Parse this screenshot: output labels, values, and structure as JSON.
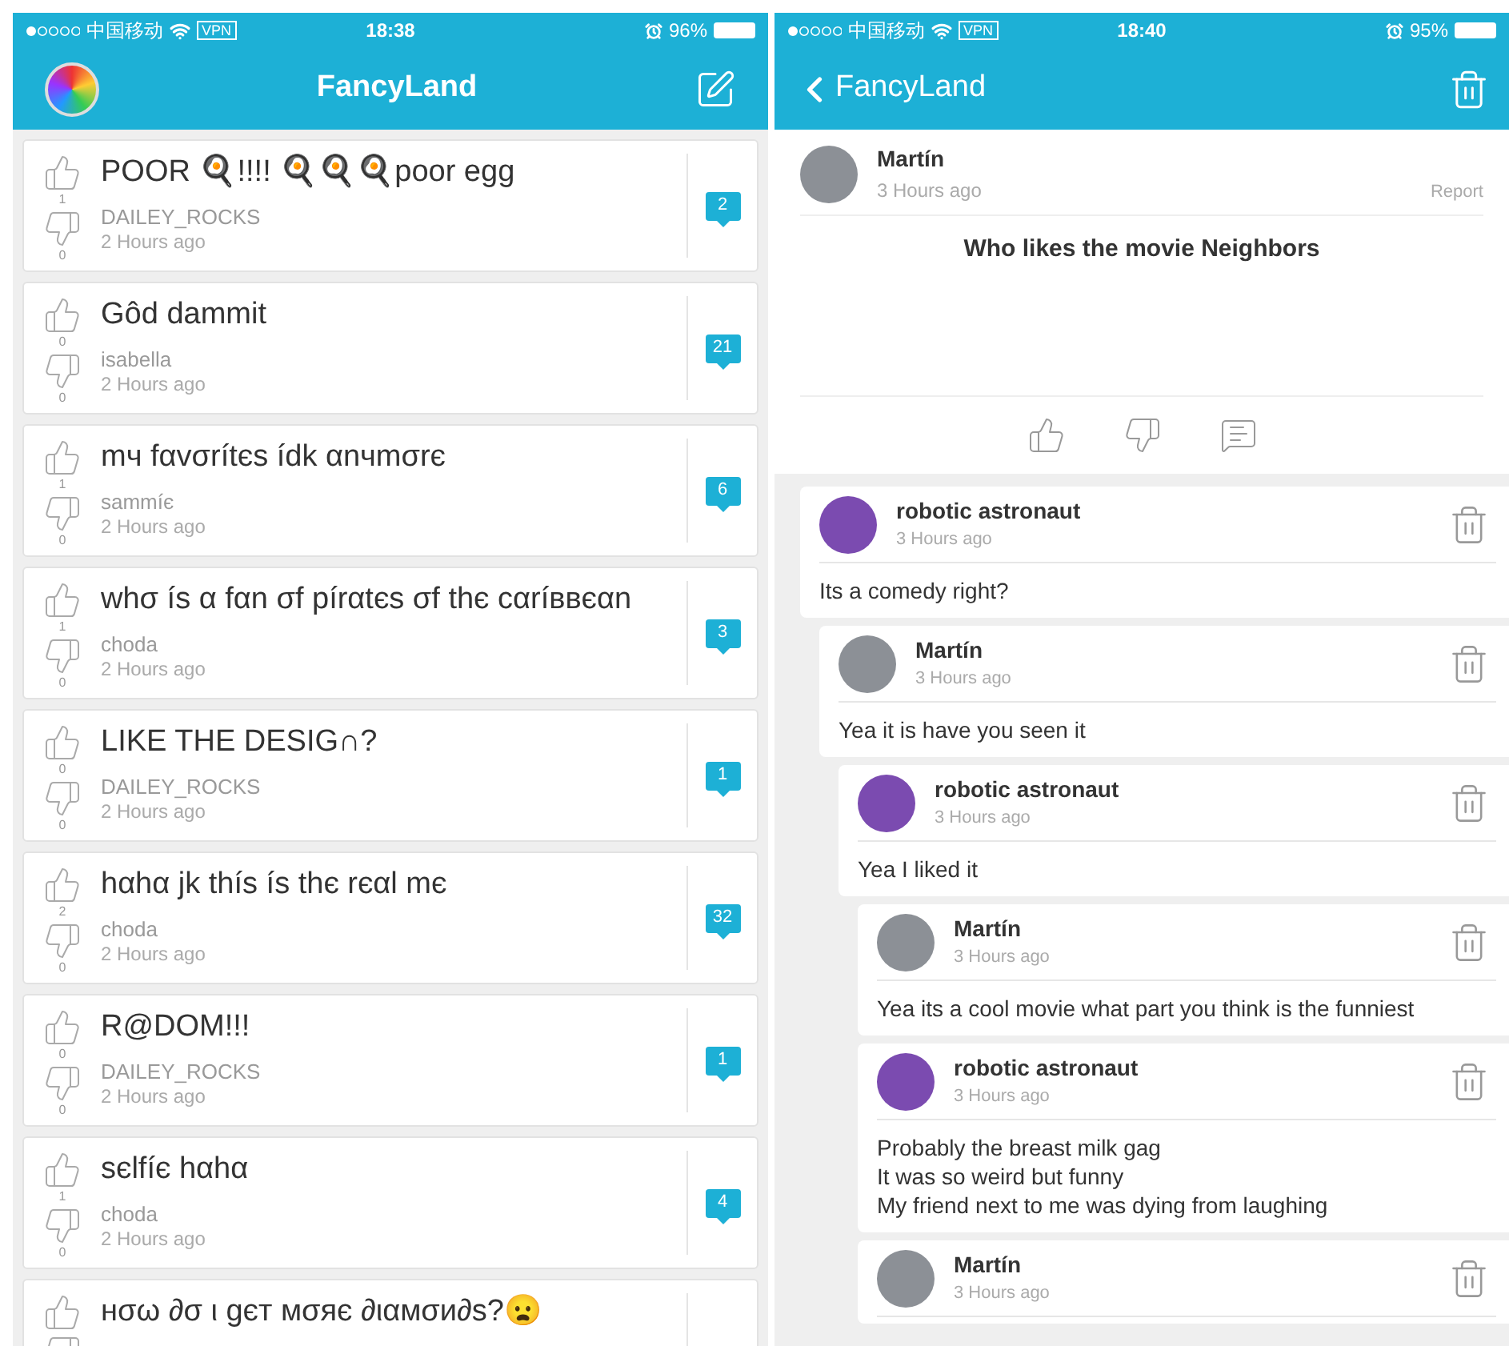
{
  "feed_screen": {
    "status_bar": {
      "carrier": "中国移动",
      "vpn": "VPN",
      "time": "18:38",
      "battery": "96%"
    },
    "nav": {
      "title": "FancyLand"
    },
    "posts": [
      {
        "title": "POOR 🍳!!!! 🍳🍳🍳poor egg",
        "author": "DAILEY_ROCKS",
        "time": "2 Hours ago",
        "likes": "1",
        "dislikes": "0",
        "comments": "2"
      },
      {
        "title": "Gôd dammit",
        "author": "isabella",
        "time": "2 Hours ago",
        "likes": "0",
        "dislikes": "0",
        "comments": "21"
      },
      {
        "title": "mч fαvσrítєs ídk αnчmσrє",
        "author": "sammíє",
        "time": "2 Hours ago",
        "likes": "1",
        "dislikes": "0",
        "comments": "6"
      },
      {
        "title": "whσ ís α fαn σf pírαtєs σf thє cαríввєαn",
        "author": "choda",
        "time": "2 Hours ago",
        "likes": "1",
        "dislikes": "0",
        "comments": "3"
      },
      {
        "title": "LIKE THE DESIG∩?",
        "author": "DAILEY_ROCKS",
        "time": "2 Hours ago",
        "likes": "0",
        "dislikes": "0",
        "comments": "1"
      },
      {
        "title": "hαhα jk thís ís thє rєαl mє",
        "author": "choda",
        "time": "2 Hours ago",
        "likes": "2",
        "dislikes": "0",
        "comments": "32"
      },
      {
        "title": "R@DOM!!!",
        "author": "DAILEY_ROCKS",
        "time": "2 Hours ago",
        "likes": "0",
        "dislikes": "0",
        "comments": "1"
      },
      {
        "title": "sєlfíє hαhα",
        "author": "choda",
        "time": "2 Hours ago",
        "likes": "1",
        "dislikes": "0",
        "comments": "4"
      },
      {
        "title": "нσω ∂σ ι gєт мσяє ∂ιαмσи∂ѕ?😦"
      }
    ]
  },
  "thread_screen": {
    "status_bar": {
      "carrier": "中国移动",
      "vpn": "VPN",
      "time": "18:40",
      "battery": "95%"
    },
    "nav": {
      "back_label": "FancyLand"
    },
    "post": {
      "author": "Martín",
      "time": "3 Hours ago",
      "report": "Report",
      "title": "Who likes the movie Neighbors"
    },
    "comments": [
      {
        "kind": "splat",
        "author": "robotic astronaut",
        "time": "3 Hours ago",
        "text": "Its a comedy right?",
        "children": [
          {
            "kind": "car",
            "author": "Martín",
            "time": "3 Hours ago",
            "text": "Yea it is have you seen it",
            "children": [
              {
                "kind": "splat",
                "author": "robotic astronaut",
                "time": "3 Hours ago",
                "text": "Yea I liked it",
                "children": [
                  {
                    "kind": "car",
                    "author": "Martín",
                    "time": "3 Hours ago",
                    "text": "Yea its a cool movie what part you think is the funniest"
                  },
                  {
                    "kind": "splat",
                    "author": "robotic astronaut",
                    "time": "3 Hours ago",
                    "text": "Probably the breast milk gag\nIt was so weird but funny\nMy friend next to me was dying from laughing"
                  },
                  {
                    "kind": "car",
                    "author": "Martín",
                    "time": "3 Hours ago"
                  }
                ]
              }
            ]
          }
        ]
      }
    ]
  }
}
